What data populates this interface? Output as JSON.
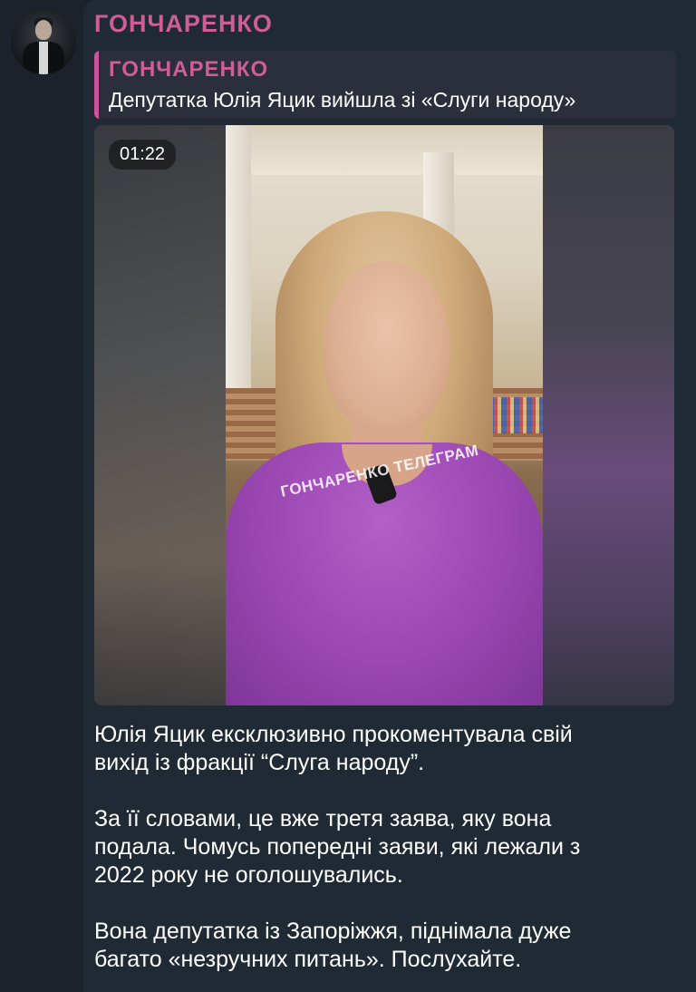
{
  "channel": {
    "name": "ГОНЧАРЕНКО",
    "avatar_icon": "user-avatar-icon"
  },
  "reply": {
    "name": "ГОНЧАРЕНКО",
    "text": "Депутатка Юлія Яцик вийшла зі «Слуги народу»"
  },
  "video": {
    "duration": "01:22",
    "watermark": "ГОНЧАРЕНКО ТЕЛЕГРАМ"
  },
  "message": {
    "paragraphs": [
      [
        "Юлія Яцик ексклюзивно прокоментувала свій",
        "вихід із фракції “Слуга народу”."
      ],
      [
        "За її словами, це вже третя заява, яку вона",
        "подала. Чомусь попередні заяви, які лежали з",
        "2022 року не оголошувались."
      ],
      [
        "Вона депутатка із Запоріжжя, піднімала дуже",
        "багато «незручних питань». Послухайте."
      ]
    ]
  },
  "colors": {
    "background": "#1b222c",
    "bubble": "#202a34",
    "accent": "#cf5d97"
  }
}
